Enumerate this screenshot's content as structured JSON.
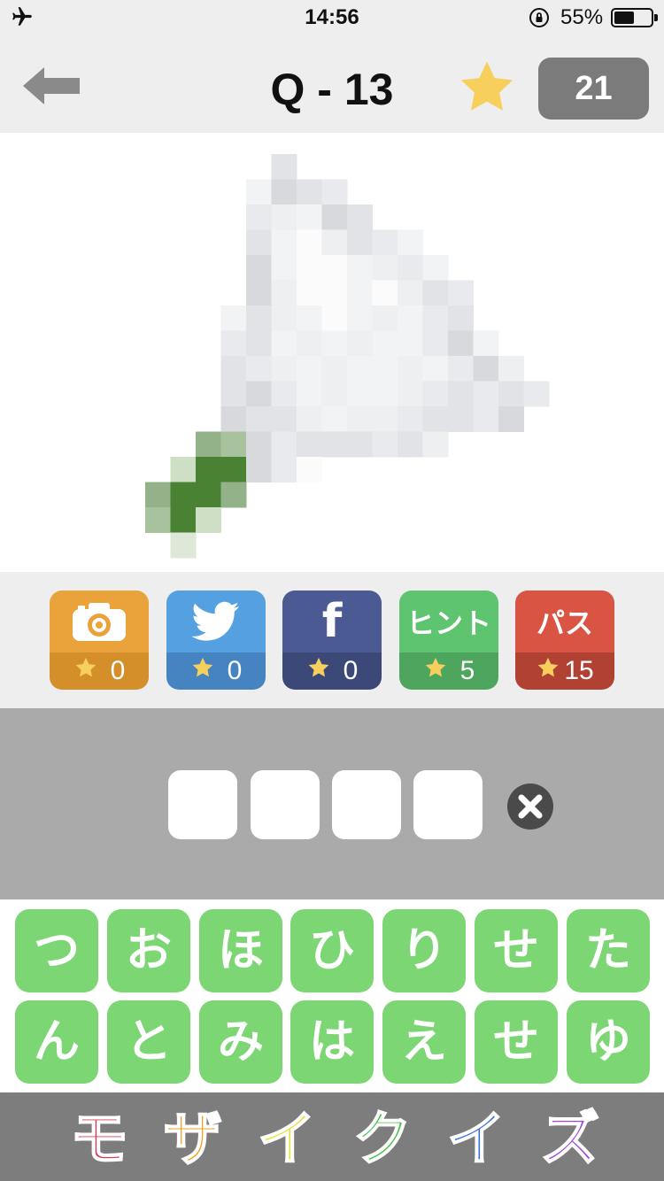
{
  "status_bar": {
    "time": "14:56",
    "battery_percent_text": "55%",
    "battery_level": 0.55,
    "icons": [
      "airplane-icon",
      "orientation-lock-icon",
      "battery-icon"
    ]
  },
  "header": {
    "back_icon": "back-arrow-icon",
    "title": "Q - 13",
    "star_icon": "star-icon",
    "star_count": "21"
  },
  "quiz_image": {
    "description_icon": "mosaic-image"
  },
  "tools": [
    {
      "id": "camera",
      "icon": "camera-icon",
      "cost": "0",
      "color": "#e9a33a",
      "bottom_color": "#d48e2a"
    },
    {
      "id": "twitter",
      "icon": "twitter-bird-icon",
      "cost": "0",
      "color": "#55a0e0",
      "bottom_color": "#4584c0"
    },
    {
      "id": "facebook",
      "icon": "facebook-icon",
      "label": "f",
      "cost": "0",
      "color": "#4b5a92",
      "bottom_color": "#3c4878"
    },
    {
      "id": "hint",
      "label": "ヒント",
      "cost": "5",
      "color": "#5fc470",
      "bottom_color": "#4ea55d"
    },
    {
      "id": "pass",
      "label": "パス",
      "cost": "15",
      "color": "#d95443",
      "bottom_color": "#b14133"
    }
  ],
  "answer": {
    "slots": [
      "",
      "",
      "",
      ""
    ],
    "clear_icon": "clear-x-icon"
  },
  "keyboard": {
    "row1": [
      "つ",
      "お",
      "ほ",
      "ひ",
      "り",
      "せ",
      "た"
    ],
    "row2": [
      "ん",
      "と",
      "み",
      "は",
      "え",
      "せ",
      "ゆ"
    ]
  },
  "footer": {
    "logo_chars": [
      "モ",
      "ザ",
      "イ",
      "ク",
      "イ",
      "ズ"
    ],
    "logo_colors": [
      "#d83b52",
      "#f0a020",
      "#e8e030",
      "#40c040",
      "#3a6fe0",
      "#a048d8"
    ]
  }
}
